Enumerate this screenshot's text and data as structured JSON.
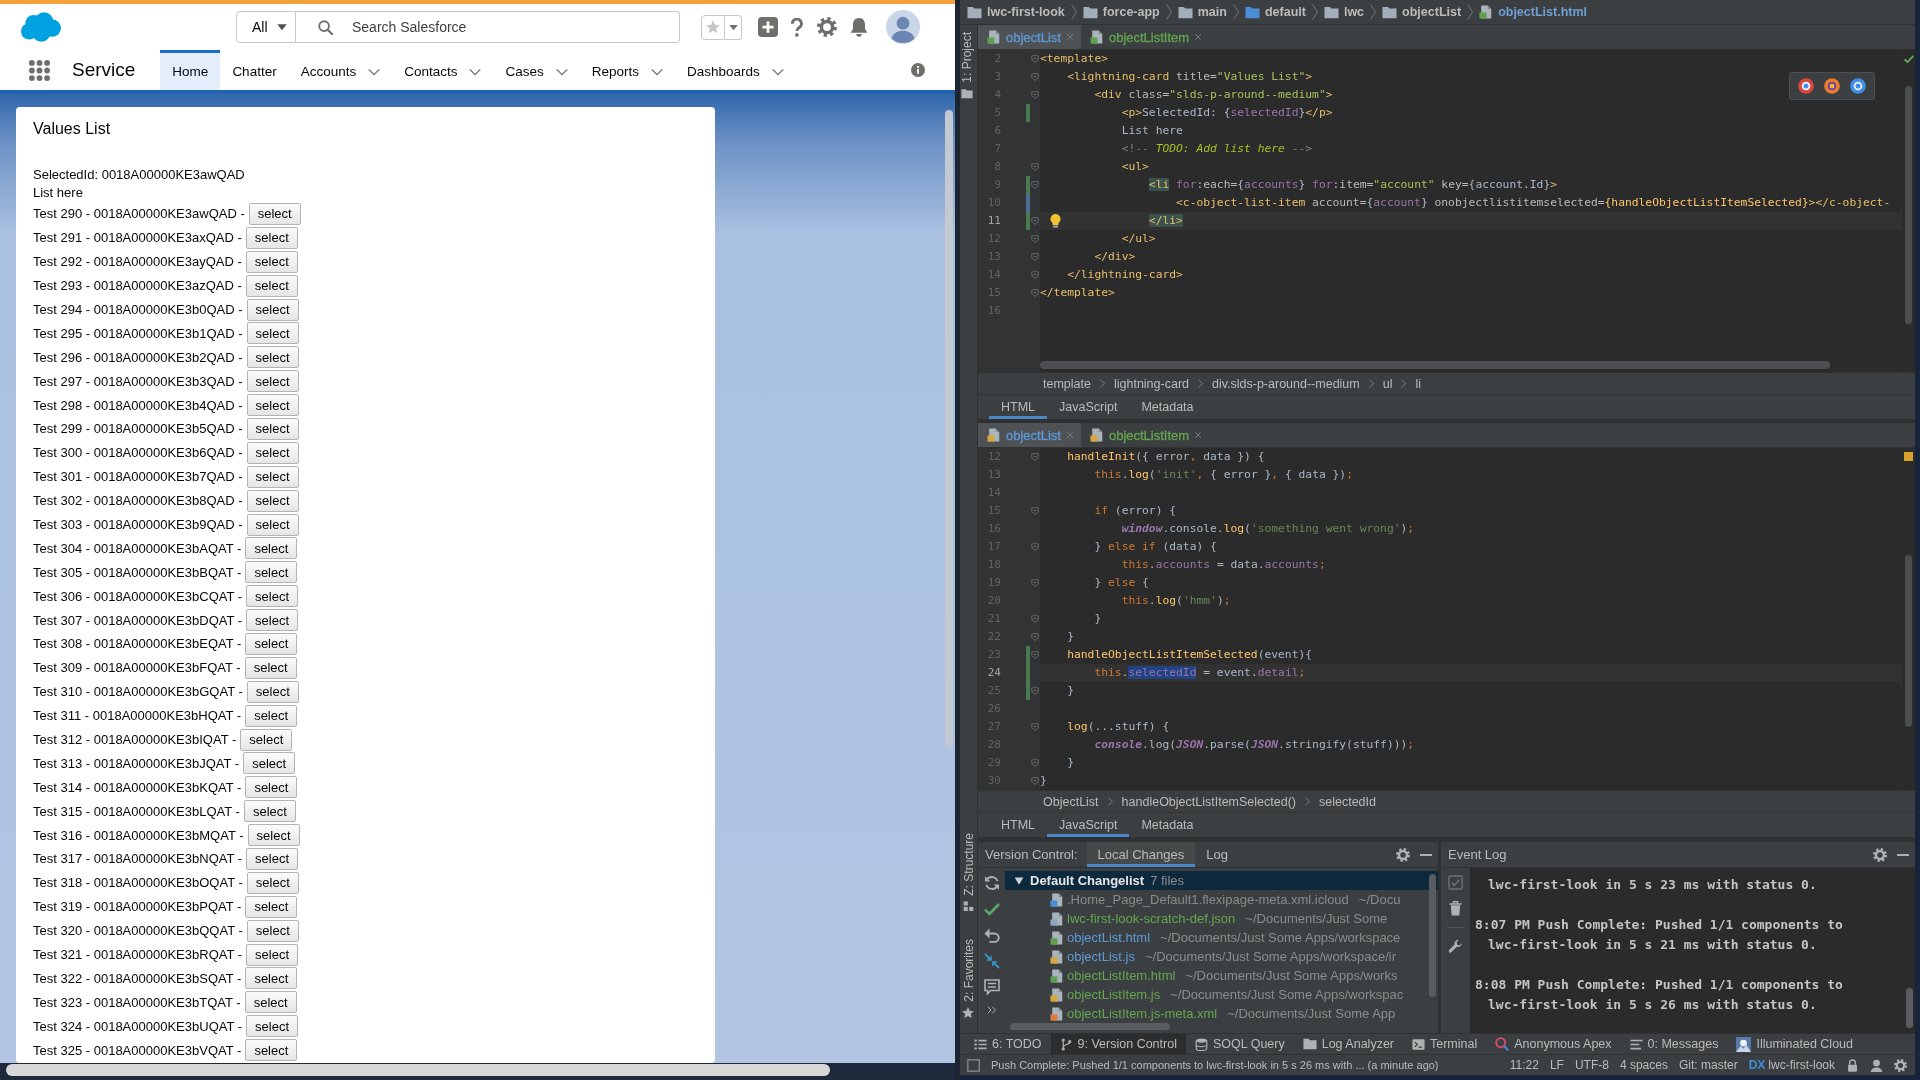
{
  "browser": {
    "header": {
      "search_scope": "All",
      "search": {
        "placeholder": "Search Salesforce"
      }
    },
    "nav": {
      "app_name": "Service",
      "tabs": [
        {
          "label": "Home",
          "selected": true,
          "has_menu": false
        },
        {
          "label": "Chatter",
          "selected": false,
          "has_menu": false
        },
        {
          "label": "Accounts",
          "selected": false,
          "has_menu": true
        },
        {
          "label": "Contacts",
          "selected": false,
          "has_menu": true
        },
        {
          "label": "Cases",
          "selected": false,
          "has_menu": true
        },
        {
          "label": "Reports",
          "selected": false,
          "has_menu": true
        },
        {
          "label": "Dashboards",
          "selected": false,
          "has_menu": true
        }
      ]
    },
    "card": {
      "title": "Values List",
      "selected_id": "SelectedId: 0018A00000KE3awQAD",
      "list_label": "List here",
      "rows": [
        {
          "text": "Test 290 - 0018A00000KE3awQAD -",
          "button": "select"
        },
        {
          "text": "Test 291 - 0018A00000KE3axQAD -",
          "button": "select"
        },
        {
          "text": "Test 292 - 0018A00000KE3ayQAD -",
          "button": "select"
        },
        {
          "text": "Test 293 - 0018A00000KE3azQAD -",
          "button": "select"
        },
        {
          "text": "Test 294 - 0018A00000KE3b0QAD -",
          "button": "select"
        },
        {
          "text": "Test 295 - 0018A00000KE3b1QAD -",
          "button": "select"
        },
        {
          "text": "Test 296 - 0018A00000KE3b2QAD -",
          "button": "select"
        },
        {
          "text": "Test 297 - 0018A00000KE3b3QAD -",
          "button": "select"
        },
        {
          "text": "Test 298 - 0018A00000KE3b4QAD -",
          "button": "select"
        },
        {
          "text": "Test 299 - 0018A00000KE3b5QAD -",
          "button": "select"
        },
        {
          "text": "Test 300 - 0018A00000KE3b6QAD -",
          "button": "select"
        },
        {
          "text": "Test 301 - 0018A00000KE3b7QAD -",
          "button": "select"
        },
        {
          "text": "Test 302 - 0018A00000KE3b8QAD -",
          "button": "select"
        },
        {
          "text": "Test 303 - 0018A00000KE3b9QAD -",
          "button": "select"
        },
        {
          "text": "Test 304 - 0018A00000KE3bAQAT -",
          "button": "select"
        },
        {
          "text": "Test 305 - 0018A00000KE3bBQAT -",
          "button": "select"
        },
        {
          "text": "Test 306 - 0018A00000KE3bCQAT -",
          "button": "select"
        },
        {
          "text": "Test 307 - 0018A00000KE3bDQAT -",
          "button": "select"
        },
        {
          "text": "Test 308 - 0018A00000KE3bEQAT -",
          "button": "select"
        },
        {
          "text": "Test 309 - 0018A00000KE3bFQAT -",
          "button": "select"
        },
        {
          "text": "Test 310 - 0018A00000KE3bGQAT -",
          "button": "select"
        },
        {
          "text": "Test 311 - 0018A00000KE3bHQAT -",
          "button": "select"
        },
        {
          "text": "Test 312 - 0018A00000KE3bIQAT -",
          "button": "select"
        },
        {
          "text": "Test 313 - 0018A00000KE3bJQAT -",
          "button": "select"
        },
        {
          "text": "Test 314 - 0018A00000KE3bKQAT -",
          "button": "select"
        },
        {
          "text": "Test 315 - 0018A00000KE3bLQAT -",
          "button": "select"
        },
        {
          "text": "Test 316 - 0018A00000KE3bMQAT -",
          "button": "select"
        },
        {
          "text": "Test 317 - 0018A00000KE3bNQAT -",
          "button": "select"
        },
        {
          "text": "Test 318 - 0018A00000KE3bOQAT -",
          "button": "select"
        },
        {
          "text": "Test 319 - 0018A00000KE3bPQAT -",
          "button": "select"
        },
        {
          "text": "Test 320 - 0018A00000KE3bQQAT -",
          "button": "select"
        },
        {
          "text": "Test 321 - 0018A00000KE3bRQAT -",
          "button": "select"
        },
        {
          "text": "Test 322 - 0018A00000KE3bSQAT -",
          "button": "select"
        },
        {
          "text": "Test 323 - 0018A00000KE3bTQAT -",
          "button": "select"
        },
        {
          "text": "Test 324 - 0018A00000KE3bUQAT -",
          "button": "select"
        },
        {
          "text": "Test 325 - 0018A00000KE3bVQAT -",
          "button": "select"
        }
      ]
    }
  },
  "ide": {
    "nav_path": [
      {
        "label": "lwc-first-look",
        "kind": "folder"
      },
      {
        "label": "force-app",
        "kind": "folder"
      },
      {
        "label": "main",
        "kind": "folder"
      },
      {
        "label": "default",
        "kind": "source"
      },
      {
        "label": "lwc",
        "kind": "folder"
      },
      {
        "label": "objectList",
        "kind": "folder"
      },
      {
        "label": "objectList.html",
        "kind": "html"
      }
    ],
    "side_tools": {
      "top": [
        {
          "label": "1: Project",
          "kind": "project"
        }
      ],
      "bottom": [
        {
          "label": "Z: Structure",
          "kind": "structure"
        },
        {
          "label": "2: Favorites",
          "kind": "favorites"
        }
      ]
    },
    "editors": [
      {
        "tabs": [
          {
            "label": "objectList",
            "kind": "html",
            "selected": true,
            "color": "#5d9ad9"
          },
          {
            "label": "objectListItem",
            "kind": "html",
            "selected": false,
            "color": "#64a650"
          }
        ],
        "intention_bulb": true,
        "lines": [
          {
            "number": "2",
            "current": false,
            "added": false,
            "modified": false,
            "fold": true,
            "tokens": [
              {
                "kind": "tag",
                "text": "<template>"
              }
            ]
          },
          {
            "number": "3",
            "current": false,
            "added": false,
            "modified": false,
            "fold": true,
            "tokens": [
              {
                "kind": "tag",
                "text": "    <lightning-card"
              },
              {
                "kind": "attr",
                "text": " title="
              },
              {
                "kind": "value",
                "text": "\"Values List\""
              },
              {
                "kind": "tag",
                "text": ">"
              }
            ]
          },
          {
            "number": "4",
            "current": false,
            "added": false,
            "modified": false,
            "fold": true,
            "tokens": [
              {
                "kind": "tag",
                "text": "        <div"
              },
              {
                "kind": "attr",
                "text": " class="
              },
              {
                "kind": "value",
                "text": "\"slds-p-around--medium\""
              },
              {
                "kind": "tag",
                "text": ">"
              }
            ]
          },
          {
            "number": "5",
            "current": false,
            "added": true,
            "modified": false,
            "fold": false,
            "tokens": [
              {
                "kind": "tag",
                "text": "            <p>"
              },
              {
                "kind": "plain",
                "text": "SelectedId: {"
              },
              {
                "kind": "field",
                "text": "selectedId"
              },
              {
                "kind": "plain",
                "text": "}"
              },
              {
                "kind": "tag",
                "text": "</p>"
              }
            ]
          },
          {
            "number": "6",
            "current": false,
            "added": false,
            "modified": false,
            "fold": false,
            "tokens": [
              {
                "kind": "plain",
                "text": "            List here"
              }
            ]
          },
          {
            "number": "7",
            "current": false,
            "added": false,
            "modified": false,
            "fold": false,
            "tokens": [
              {
                "kind": "comment",
                "text": "            <!-- "
              },
              {
                "kind": "todo",
                "text": "TODO: Add list here"
              },
              {
                "kind": "comment",
                "text": " -->"
              }
            ]
          },
          {
            "number": "8",
            "current": false,
            "added": false,
            "modified": false,
            "fold": true,
            "tokens": [
              {
                "kind": "tag",
                "text": "            <ul>"
              }
            ]
          },
          {
            "number": "9",
            "current": false,
            "added": true,
            "modified": false,
            "fold": true,
            "tokens": [
              {
                "kind": "match",
                "text": "                <li"
              },
              {
                "kind": "field",
                "text": " for"
              },
              {
                "kind": "attr",
                "text": ":each="
              },
              {
                "kind": "plain",
                "text": "{"
              },
              {
                "kind": "field",
                "text": "accounts"
              },
              {
                "kind": "plain",
                "text": "}"
              },
              {
                "kind": "field",
                "text": " for"
              },
              {
                "kind": "attr",
                "text": ":item="
              },
              {
                "kind": "value",
                "text": "\"account\""
              },
              {
                "kind": "attr",
                "text": " key="
              },
              {
                "kind": "plain",
                "text": "{account.Id}"
              },
              {
                "kind": "tag",
                "text": ">"
              }
            ]
          },
          {
            "number": "10",
            "current": false,
            "added": false,
            "modified": true,
            "fold": false,
            "tokens": [
              {
                "kind": "tag",
                "text": "                    <c-object-list-item"
              },
              {
                "kind": "attr",
                "text": " account="
              },
              {
                "kind": "plain",
                "text": "{"
              },
              {
                "kind": "field",
                "text": "account"
              },
              {
                "kind": "plain",
                "text": "}"
              },
              {
                "kind": "attr",
                "text": " onobjectlistitemselected="
              },
              {
                "kind": "func",
                "text": "{handleObjectListItemSelected}"
              },
              {
                "kind": "tag",
                "text": "></c-object-"
              }
            ]
          },
          {
            "number": "11",
            "current": true,
            "added": true,
            "modified": false,
            "fold": true,
            "tokens": [
              {
                "kind": "match",
                "text": "                </li>"
              }
            ]
          },
          {
            "number": "12",
            "current": false,
            "added": false,
            "modified": false,
            "fold": true,
            "tokens": [
              {
                "kind": "tag",
                "text": "            </ul>"
              }
            ]
          },
          {
            "number": "13",
            "current": false,
            "added": false,
            "modified": false,
            "fold": true,
            "tokens": [
              {
                "kind": "tag",
                "text": "        </div>"
              }
            ]
          },
          {
            "number": "14",
            "current": false,
            "added": false,
            "modified": false,
            "fold": true,
            "tokens": [
              {
                "kind": "tag",
                "text": "    </lightning-card>"
              }
            ]
          },
          {
            "number": "15",
            "current": false,
            "added": false,
            "modified": false,
            "fold": true,
            "tokens": [
              {
                "kind": "tag",
                "text": "</template>"
              }
            ]
          },
          {
            "number": "16",
            "current": false,
            "added": false,
            "modified": false,
            "fold": false
          }
        ],
        "breadcrumb": [
          "template",
          "lightning-card",
          "div.slds-p-around--medium",
          "ul",
          "li"
        ],
        "view_tabs": [
          {
            "label": "HTML",
            "selected": true
          },
          {
            "label": "JavaScript",
            "selected": false
          },
          {
            "label": "Metadata",
            "selected": false
          }
        ]
      },
      {
        "tabs": [
          {
            "label": "objectList",
            "kind": "js",
            "selected": true,
            "color": "#5d9ad9"
          },
          {
            "label": "objectListItem",
            "kind": "js",
            "selected": false,
            "color": "#64a650"
          }
        ],
        "lines": [
          {
            "number": "12",
            "current": false,
            "added": false,
            "modified": false,
            "fold": true,
            "tokens": [
              {
                "kind": "func",
                "text": "    handleInit"
              },
              {
                "kind": "plain",
                "text": "({ error"
              },
              {
                "kind": "keyword",
                "text": ", "
              },
              {
                "kind": "plain",
                "text": "data }) {"
              }
            ]
          },
          {
            "number": "13",
            "current": false,
            "added": false,
            "modified": false,
            "fold": false,
            "tokens": [
              {
                "kind": "keyword",
                "text": "        this"
              },
              {
                "kind": "plain",
                "text": "."
              },
              {
                "kind": "func",
                "text": "log"
              },
              {
                "kind": "plain",
                "text": "("
              },
              {
                "kind": "string",
                "text": "'init'"
              },
              {
                "kind": "keyword",
                "text": ", "
              },
              {
                "kind": "plain",
                "text": "{ error }"
              },
              {
                "kind": "keyword",
                "text": ", "
              },
              {
                "kind": "plain",
                "text": "{ data })"
              },
              {
                "kind": "keyword",
                "text": ";"
              }
            ]
          },
          {
            "number": "14",
            "current": false,
            "added": false,
            "modified": false,
            "fold": false
          },
          {
            "number": "15",
            "current": false,
            "added": false,
            "modified": false,
            "fold": true,
            "tokens": [
              {
                "kind": "keyword",
                "text": "        if"
              },
              {
                "kind": "plain",
                "text": " (error) {"
              }
            ]
          },
          {
            "number": "16",
            "current": false,
            "added": false,
            "modified": false,
            "fold": false,
            "tokens": [
              {
                "kind": "global",
                "text": "            window"
              },
              {
                "kind": "plain",
                "text": ".console."
              },
              {
                "kind": "func",
                "text": "log"
              },
              {
                "kind": "plain",
                "text": "("
              },
              {
                "kind": "string",
                "text": "'something went wrong'"
              },
              {
                "kind": "plain",
                "text": ")"
              },
              {
                "kind": "keyword",
                "text": ";"
              }
            ]
          },
          {
            "number": "17",
            "current": false,
            "added": false,
            "modified": false,
            "fold": true,
            "tokens": [
              {
                "kind": "plain",
                "text": "        } "
              },
              {
                "kind": "keyword",
                "text": "else if"
              },
              {
                "kind": "plain",
                "text": " (data) {"
              }
            ]
          },
          {
            "number": "18",
            "current": false,
            "added": false,
            "modified": false,
            "fold": false,
            "tokens": [
              {
                "kind": "keyword",
                "text": "            this"
              },
              {
                "kind": "plain",
                "text": "."
              },
              {
                "kind": "field",
                "text": "accounts"
              },
              {
                "kind": "plain",
                "text": " = data."
              },
              {
                "kind": "field",
                "text": "accounts"
              },
              {
                "kind": "keyword",
                "text": ";"
              }
            ]
          },
          {
            "number": "19",
            "current": false,
            "added": false,
            "modified": false,
            "fold": true,
            "tokens": [
              {
                "kind": "plain",
                "text": "        } "
              },
              {
                "kind": "keyword",
                "text": "else"
              },
              {
                "kind": "plain",
                "text": " {"
              }
            ]
          },
          {
            "number": "20",
            "current": false,
            "added": false,
            "modified": false,
            "fold": false,
            "tokens": [
              {
                "kind": "keyword",
                "text": "            this"
              },
              {
                "kind": "plain",
                "text": "."
              },
              {
                "kind": "func",
                "text": "log"
              },
              {
                "kind": "plain",
                "text": "("
              },
              {
                "kind": "string",
                "text": "'hmm'"
              },
              {
                "kind": "plain",
                "text": ")"
              },
              {
                "kind": "keyword",
                "text": ";"
              }
            ]
          },
          {
            "number": "21",
            "current": false,
            "added": false,
            "modified": false,
            "fold": true,
            "tokens": [
              {
                "kind": "plain",
                "text": "        }"
              }
            ]
          },
          {
            "number": "22",
            "current": false,
            "added": false,
            "modified": false,
            "fold": true,
            "tokens": [
              {
                "kind": "plain",
                "text": "    }"
              }
            ]
          },
          {
            "number": "23",
            "current": false,
            "added": true,
            "modified": false,
            "fold": true,
            "tokens": [
              {
                "kind": "func",
                "text": "    handleObjectListItemSelected"
              },
              {
                "kind": "plain",
                "text": "(event){"
              }
            ]
          },
          {
            "number": "24",
            "current": true,
            "added": true,
            "modified": false,
            "fold": false,
            "tokens": [
              {
                "kind": "keyword",
                "text": "        this"
              },
              {
                "kind": "plain",
                "text": "."
              },
              {
                "kind": "selection",
                "text": "selectedId"
              },
              {
                "kind": "plain",
                "text": " = event."
              },
              {
                "kind": "field",
                "text": "detail"
              },
              {
                "kind": "keyword",
                "text": ";"
              }
            ]
          },
          {
            "number": "25",
            "current": false,
            "added": true,
            "modified": false,
            "fold": true,
            "tokens": [
              {
                "kind": "plain",
                "text": "    }"
              }
            ]
          },
          {
            "number": "26",
            "current": false,
            "added": false,
            "modified": false,
            "fold": false
          },
          {
            "number": "27",
            "current": false,
            "added": false,
            "modified": false,
            "fold": true,
            "tokens": [
              {
                "kind": "func",
                "text": "    log"
              },
              {
                "kind": "plain",
                "text": "(...stuff) {"
              }
            ]
          },
          {
            "number": "28",
            "current": false,
            "added": false,
            "modified": false,
            "fold": false,
            "tokens": [
              {
                "kind": "global",
                "text": "        console"
              },
              {
                "kind": "plain",
                "text": ".log("
              },
              {
                "kind": "global",
                "text": "JSON"
              },
              {
                "kind": "plain",
                "text": ".parse("
              },
              {
                "kind": "global",
                "text": "JSON"
              },
              {
                "kind": "plain",
                "text": ".stringify(stuff)))"
              },
              {
                "kind": "keyword",
                "text": ";"
              }
            ]
          },
          {
            "number": "29",
            "current": false,
            "added": false,
            "modified": false,
            "fold": true,
            "tokens": [
              {
                "kind": "plain",
                "text": "    }"
              }
            ]
          },
          {
            "number": "30",
            "current": false,
            "added": false,
            "modified": false,
            "fold": true,
            "tokens": [
              {
                "kind": "plain",
                "text": "}"
              }
            ]
          }
        ],
        "breadcrumb": [
          "ObjectList",
          "handleObjectListItemSelected()",
          "selectedId"
        ],
        "view_tabs": [
          {
            "label": "HTML",
            "selected": false
          },
          {
            "label": "JavaScript",
            "selected": true
          },
          {
            "label": "Metadata",
            "selected": false
          }
        ]
      }
    ],
    "version_control": {
      "title": "Version Control:",
      "tabs": [
        {
          "label": "Local Changes",
          "selected": true
        },
        {
          "label": "Log",
          "selected": false
        }
      ],
      "changelist": {
        "name": "Default Changelist",
        "count": "7 files",
        "expanded": true,
        "files": [
          {
            "name": ".Home_Page_Default1.flexipage-meta.xml.icloud",
            "path": "~/Docu",
            "kind": "unknown",
            "color": "#8a8a8a"
          },
          {
            "name": "lwc-first-look-scratch-def.json",
            "path": "~/Documents/Just Some",
            "kind": "json",
            "color": "#64a650"
          },
          {
            "name": "objectList.html",
            "path": "~/Documents/Just Some Apps/workspace",
            "kind": "html",
            "color": "#5d9ad9"
          },
          {
            "name": "objectList.js",
            "path": "~/Documents/Just Some Apps/workspace/ir",
            "kind": "js",
            "color": "#5d9ad9"
          },
          {
            "name": "objectListItem.html",
            "path": "~/Documents/Just Some Apps/works",
            "kind": "html",
            "color": "#64a650"
          },
          {
            "name": "objectListItem.js",
            "path": "~/Documents/Just Some Apps/workspac",
            "kind": "js",
            "color": "#64a650"
          },
          {
            "name": "objectListItem.js-meta.xml",
            "path": "~/Documents/Just Some App",
            "kind": "xml",
            "color": "#64a650"
          }
        ]
      }
    },
    "event_log": {
      "title": "Event Log",
      "entries": [
        {
          "lines": [
            "lwc-first-look in 5 s 23 ms with status 0."
          ]
        },
        {
          "lines": [
            "8:07 PM Push Complete: Pushed 1/1 components to",
            "lwc-first-look in 5 s 21 ms with status 0."
          ]
        },
        {
          "lines": [
            "8:08 PM Push Complete: Pushed 1/1 components to",
            "lwc-first-look in 5 s 26 ms with status 0."
          ]
        }
      ]
    },
    "tool_windows": [
      {
        "label": "6: TODO",
        "kind": "todo",
        "selected": false
      },
      {
        "label": "9: Version Control",
        "kind": "vcs",
        "selected": true
      },
      {
        "label": "SOQL Query",
        "kind": "soql",
        "selected": false
      },
      {
        "label": "Log Analyzer",
        "kind": "log",
        "selected": false
      },
      {
        "label": "Terminal",
        "kind": "terminal",
        "selected": false
      },
      {
        "label": "Anonymous Apex",
        "kind": "apex",
        "selected": false
      },
      {
        "label": "0: Messages",
        "kind": "messages",
        "selected": false
      },
      {
        "label": "Illuminated Cloud",
        "kind": "cloud",
        "selected": false
      }
    ],
    "status_bar": {
      "message": "Push Complete: Pushed 1/1 components to lwc-first-look in 5 s 26 ms with ... (a minute ago)",
      "items": [
        "11:22",
        "LF",
        "UTF-8",
        "4 spaces",
        "Git: master"
      ],
      "project": {
        "badge": "DX",
        "name": "lwc-first-look"
      }
    }
  }
}
